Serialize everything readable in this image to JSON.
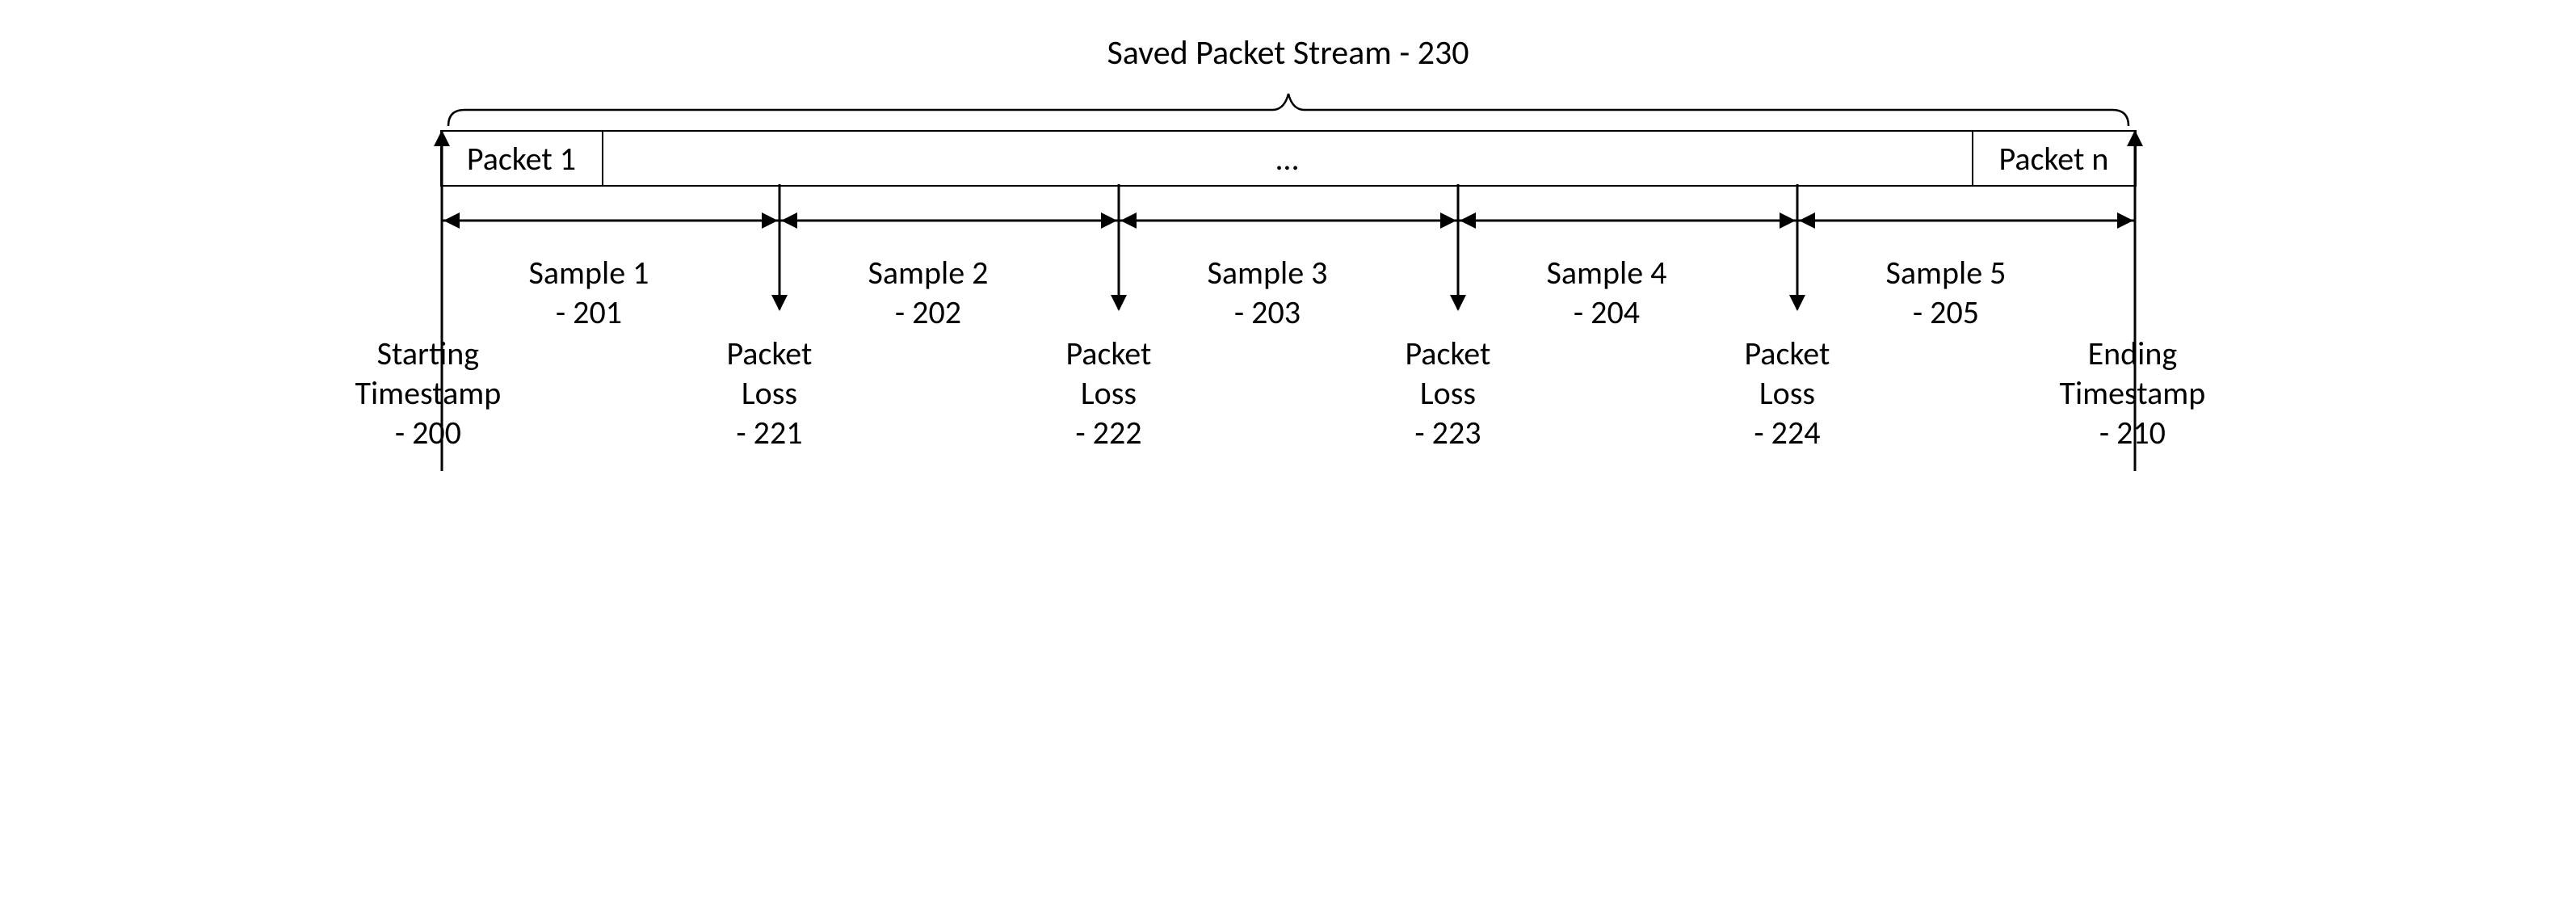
{
  "title": "Saved Packet Stream - 230",
  "packets": {
    "first": "Packet 1",
    "middle": "…",
    "last": "Packet n"
  },
  "samples": [
    {
      "label": "Sample 1",
      "ref": "- 201"
    },
    {
      "label": "Sample 2",
      "ref": "- 202"
    },
    {
      "label": "Sample 3",
      "ref": "- 203"
    },
    {
      "label": "Sample 4",
      "ref": "- 204"
    },
    {
      "label": "Sample 5",
      "ref": "- 205"
    }
  ],
  "start_ts": {
    "line1": "Starting",
    "line2": "Timestamp",
    "ref": "- 200"
  },
  "end_ts": {
    "line1": "Ending",
    "line2": "Timestamp",
    "ref": "- 210"
  },
  "losses": [
    {
      "line1": "Packet",
      "line2": "Loss",
      "ref": "- 221"
    },
    {
      "line1": "Packet",
      "line2": "Loss",
      "ref": "- 222"
    },
    {
      "line1": "Packet",
      "line2": "Loss",
      "ref": "- 223"
    },
    {
      "line1": "Packet",
      "line2": "Loss",
      "ref": "- 224"
    }
  ]
}
